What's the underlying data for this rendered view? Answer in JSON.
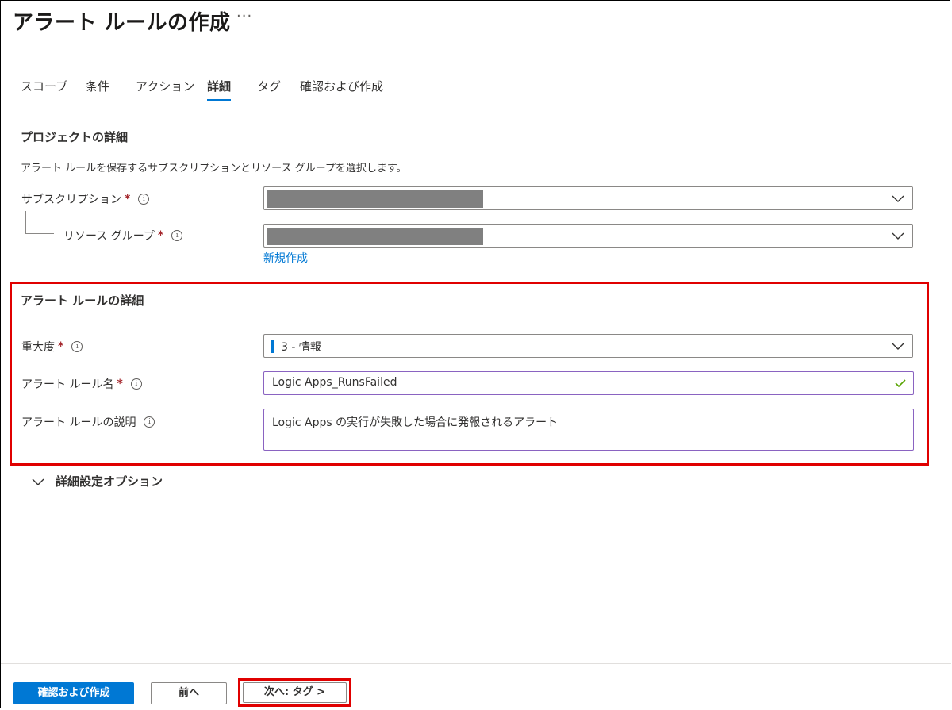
{
  "page": {
    "title": "アラート ルールの作成",
    "more_label": "···"
  },
  "tabs": [
    {
      "label": "スコープ"
    },
    {
      "label": "条件"
    },
    {
      "label": "アクション"
    },
    {
      "label": "詳細"
    },
    {
      "label": "タグ"
    },
    {
      "label": "確認および作成"
    }
  ],
  "active_tab": "詳細",
  "project": {
    "heading": "プロジェクトの詳細",
    "description": "アラート ルールを保存するサブスクリプションとリソース グループを選択します。",
    "subscription_label": "サブスクリプション",
    "resource_group_label": "リソース グループ",
    "create_new_link": "新規作成",
    "required_mark": "*",
    "info_glyph": "i"
  },
  "alert_rule": {
    "heading": "アラート ルールの詳細",
    "severity_label": "重大度",
    "severity_value": "3 - 情報",
    "name_label": "アラート ルール名",
    "name_value": "Logic Apps_RunsFailed",
    "description_label": "アラート ルールの説明",
    "description_value": "Logic Apps の実行が失敗した場合に発報されるアラート"
  },
  "advanced": {
    "label": "詳細設定オプション"
  },
  "footer": {
    "review_create": "確認および作成",
    "previous": "前へ",
    "next": "次へ: タグ >"
  },
  "colors": {
    "accent": "#0078d4",
    "highlight_border": "#e00000",
    "required": "#a4262c",
    "valid_check": "#57a300"
  },
  "icons": [
    "chevron-down-icon",
    "info-icon",
    "checkmark-icon"
  ]
}
